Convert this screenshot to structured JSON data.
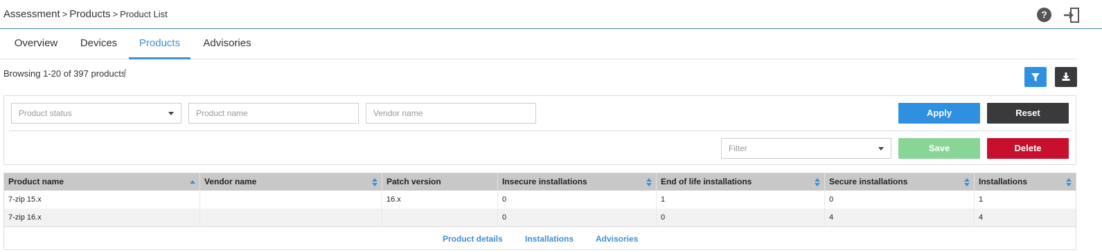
{
  "header": {
    "breadcrumb": [
      "Assessment",
      "Products",
      "Product List"
    ],
    "separator": ">"
  },
  "tabs": [
    {
      "label": "Overview",
      "active": false
    },
    {
      "label": "Devices",
      "active": false
    },
    {
      "label": "Products",
      "active": true
    },
    {
      "label": "Advisories",
      "active": false
    }
  ],
  "summary": {
    "browsing_text": "Browsing 1-20 of 397 products",
    "info_glyph": "i"
  },
  "filters": {
    "product_status_placeholder": "Product status",
    "product_name_placeholder": "Product name",
    "vendor_name_placeholder": "Vendor name",
    "saved_filter_placeholder": "Filter",
    "apply_label": "Apply",
    "reset_label": "Reset",
    "save_label": "Save",
    "delete_label": "Delete"
  },
  "table": {
    "columns": [
      {
        "label": "Product name",
        "sort": "asc"
      },
      {
        "label": "Vendor name",
        "sort": "both"
      },
      {
        "label": "Patch version",
        "sort": "none"
      },
      {
        "label": "Insecure installations",
        "sort": "both"
      },
      {
        "label": "End of life installations",
        "sort": "both"
      },
      {
        "label": "Secure installations",
        "sort": "both"
      },
      {
        "label": "Installations",
        "sort": "both"
      }
    ],
    "rows": [
      [
        "7-zip 15.x",
        "",
        "16.x",
        "0",
        "1",
        "0",
        "1"
      ],
      [
        "7-zip 16.x",
        "",
        "",
        "0",
        "0",
        "4",
        "4"
      ]
    ],
    "footer_links": [
      "Product details",
      "Installations",
      "Advisories"
    ]
  },
  "colors": {
    "accent": "#3d8fd6",
    "apply": "#2f8fe0",
    "reset": "#3a3a3d",
    "save": "#88d596",
    "delete": "#c8102e",
    "header_row": "#c8c8c8"
  },
  "icons": {
    "help": "help-icon",
    "logout": "logout-icon",
    "info": "info-icon",
    "filter": "funnel-icon",
    "download": "download-icon"
  }
}
